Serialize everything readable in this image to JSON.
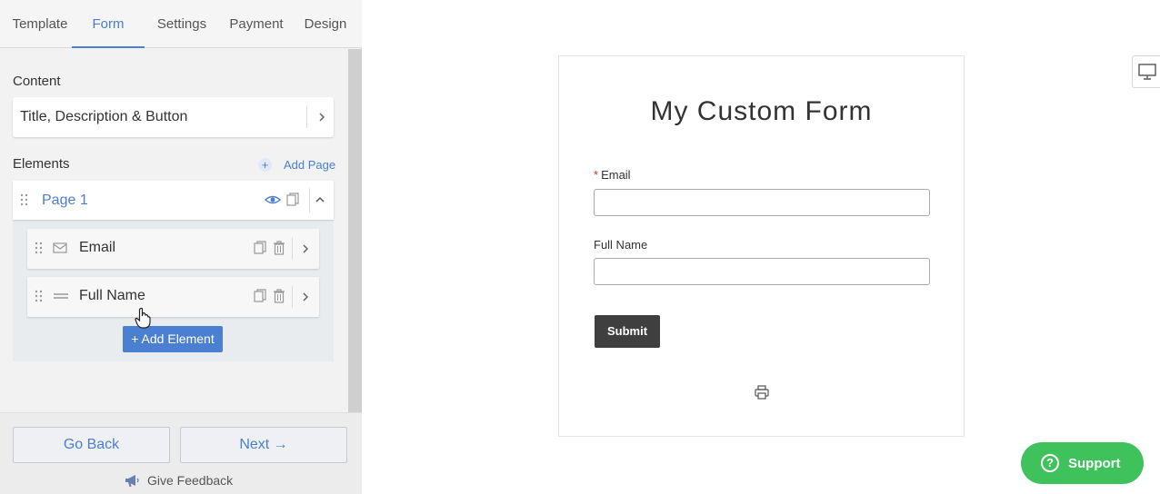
{
  "tabs": [
    {
      "label": "Template",
      "active": false
    },
    {
      "label": "Form",
      "active": true
    },
    {
      "label": "Settings",
      "active": false
    },
    {
      "label": "Payment",
      "active": false
    },
    {
      "label": "Design",
      "active": false
    }
  ],
  "content": {
    "heading": "Content",
    "card_label": "Title, Description & Button"
  },
  "elements": {
    "heading": "Elements",
    "add_page_label": "Add Page",
    "page": {
      "title": "Page 1"
    },
    "items": [
      {
        "label": "Email",
        "icon": "envelope-icon"
      },
      {
        "label": "Full Name",
        "icon": "text-lines-icon"
      }
    ],
    "add_element_label": "+ Add Element"
  },
  "footer": {
    "back_label": "Go Back",
    "next_label": "Next →",
    "feedback_label": "Give Feedback"
  },
  "preview": {
    "title": "My Custom Form",
    "fields": [
      {
        "label": "Email",
        "required": "*",
        "value": ""
      },
      {
        "label": "Full Name",
        "required": "",
        "value": ""
      }
    ],
    "submit_label": "Submit"
  },
  "support": {
    "label": "Support",
    "icon_glyph": "?"
  },
  "colors": {
    "accent": "#4a7fd1",
    "support": "#3fc25c",
    "submit": "#3f3f3f",
    "required": "#c0392b"
  }
}
